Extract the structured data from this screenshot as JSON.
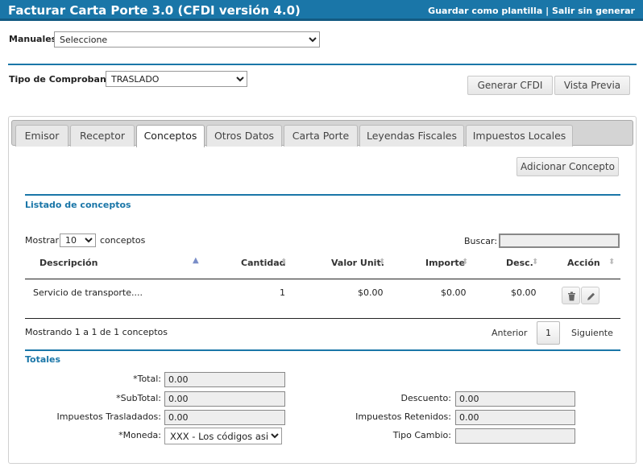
{
  "header": {
    "title": "Facturar Carta Porte 3.0 (CFDI versión 4.0)",
    "save_template": "Guardar como plantilla",
    "separator": "|",
    "exit": "Salir sin generar"
  },
  "manuales": {
    "label": "Manuales:",
    "selected": "Seleccione"
  },
  "comprobante": {
    "label": "Tipo de Comprobante:",
    "selected": "TRASLADO"
  },
  "actions": {
    "generate": "Generar CFDI",
    "preview": "Vista Previa"
  },
  "tabs": [
    "Emisor",
    "Receptor",
    "Conceptos",
    "Otros Datos",
    "Carta Porte",
    "Leyendas Fiscales",
    "Impuestos Locales"
  ],
  "conceptos": {
    "add_button": "Adicionar Concepto",
    "list_title": "Listado de conceptos",
    "show_label": "Mostrar",
    "page_size": "10",
    "show_suffix": "conceptos",
    "search_label": "Buscar:",
    "search_value": "",
    "columns": [
      "Descripción",
      "Cantidad",
      "Valor Unit.",
      "Importe",
      "Desc.",
      "Acción"
    ],
    "rows": [
      {
        "descripcion": "Servicio de transporte....",
        "cantidad": "1",
        "valor_unit": "$0.00",
        "importe": "$0.00",
        "desc": "$0.00"
      }
    ],
    "info": "Mostrando 1 a 1 de 1 conceptos",
    "prev": "Anterior",
    "current_page": "1",
    "next": "Siguiente"
  },
  "totales": {
    "title": "Totales",
    "total_label": "*Total:",
    "total_value": "0.00",
    "subtotal_label": "*SubTotal:",
    "subtotal_value": "0.00",
    "descuento_label": "Descuento:",
    "descuento_value": "0.00",
    "trasladados_label": "Impuestos Trasladados:",
    "trasladados_value": "0.00",
    "retenidos_label": "Impuestos Retenidos:",
    "retenidos_value": "0.00",
    "moneda_label": "*Moneda:",
    "moneda_value": "XXX - Los códigos asig",
    "tipo_cambio_label": "Tipo Cambio:",
    "tipo_cambio_value": ""
  },
  "icons": {
    "delete": "trash-icon",
    "edit": "pencil-icon",
    "sort": "sort-arrows-icon"
  },
  "colors": {
    "primary": "#1a76a8"
  }
}
